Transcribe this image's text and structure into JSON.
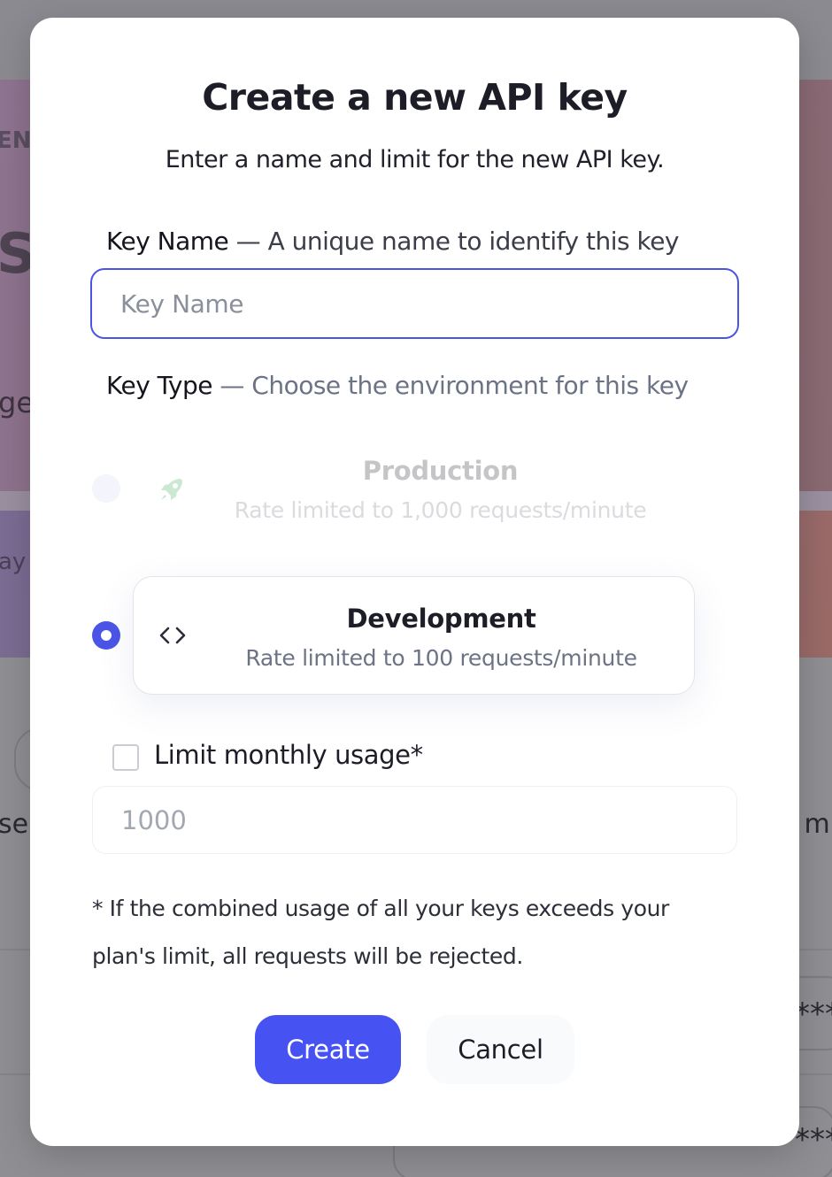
{
  "background": {
    "fragments": [
      "ENT",
      "S",
      "ge",
      "ay a",
      "se",
      "n m",
      "***",
      "***"
    ]
  },
  "modal": {
    "title": "Create a new API key",
    "subtitle": "Enter a name and limit for the new API key.",
    "key_name": {
      "label": "Key Name",
      "hint": " — A unique name to identify this key",
      "placeholder": "Key Name",
      "value": ""
    },
    "key_type": {
      "label": "Key Type",
      "hint": " — Choose the environment for this key",
      "options": [
        {
          "title": "Production",
          "description": "Rate limited to 1,000 requests/minute",
          "icon": "rocket-icon",
          "selected": false,
          "disabled": true
        },
        {
          "title": "Development",
          "description": "Rate limited to 100 requests/minute",
          "icon": "code-icon",
          "selected": true,
          "disabled": false
        }
      ]
    },
    "monthly_limit": {
      "label": "Limit monthly usage*",
      "checked": false,
      "placeholder": "1000"
    },
    "footnote": "* If the combined usage of all your keys exceeds your plan's limit, all requests will be rejected.",
    "buttons": {
      "create": "Create",
      "cancel": "Cancel"
    }
  },
  "colors": {
    "accent": "#4653f2",
    "focus_border": "#4a55e6",
    "rocket_green": "#2fa84f"
  }
}
